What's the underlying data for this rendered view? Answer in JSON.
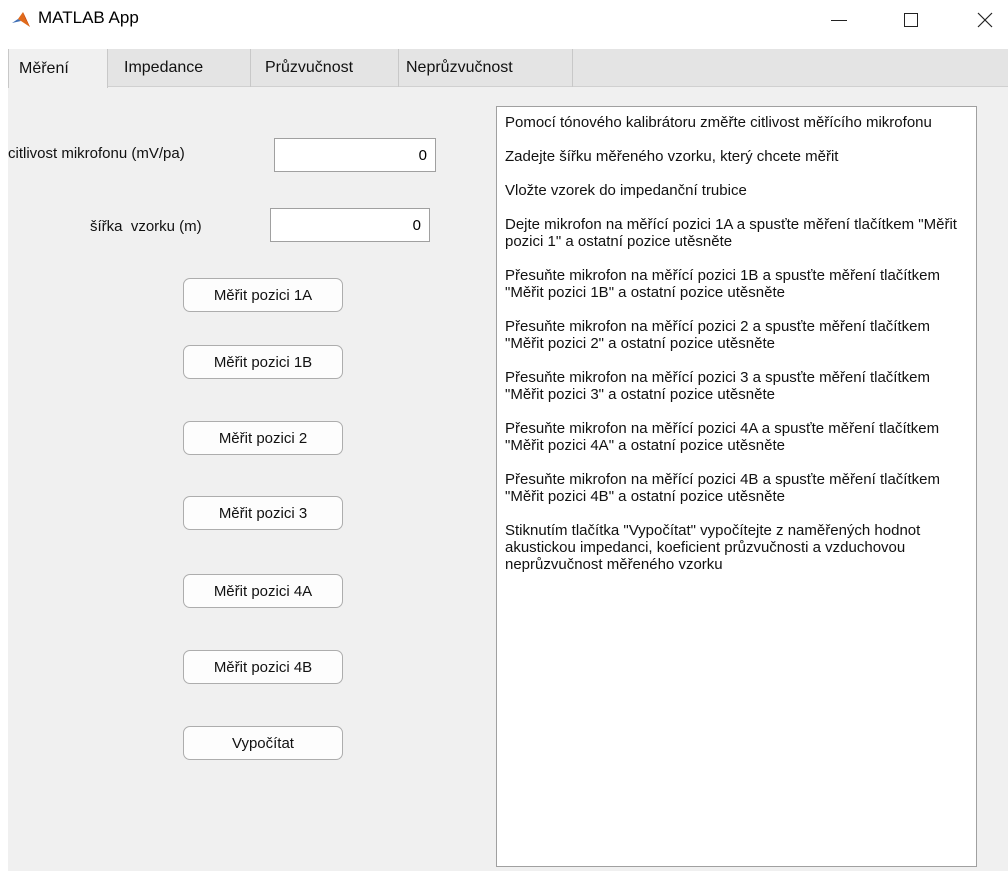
{
  "window": {
    "title": "MATLAB App",
    "icon": "matlab-logo-icon"
  },
  "tabs": [
    {
      "label": "Měření",
      "active": true
    },
    {
      "label": "Impedance",
      "active": false
    },
    {
      "label": "Průzvučnost",
      "active": false
    },
    {
      "label": "Neprůzvučnost",
      "active": false
    }
  ],
  "form": {
    "sensitivity_label": "citlivost mikrofonu (mV/pa)",
    "sensitivity_value": "0",
    "width_label": "šířka  vzorku (m)",
    "width_value": "0"
  },
  "buttons": [
    "Měřit pozici 1A",
    "Měřit pozici 1B",
    "Měřit pozici 2",
    "Měřit pozici 3",
    "Měřit pozici 4A",
    "Měřit pozici 4B",
    "Vypočítat"
  ],
  "instructions": [
    "Pomocí tónového kalibrátoru změřte citlivost měřícího mikrofonu",
    "Zadejte šířku měřeného vzorku, který chcete měřit",
    "Vložte vzorek do impedanční trubice",
    "Dejte mikrofon na měřící pozici 1A a spusťte měření tlačítkem \"Měřit pozici 1\" a ostatní pozice utěsněte",
    "Přesuňte mikrofon na měřící pozici 1B a spusťte měření tlačítkem \"Měřit pozici 1B\" a ostatní pozice utěsněte",
    "Přesuňte mikrofon na měřící pozici 2 a spusťte měření tlačítkem \"Měřit pozici 2\" a ostatní pozice utěsněte",
    "Přesuňte mikrofon na měřící pozici 3 a spusťte měření tlačítkem \"Měřit pozici 3\" a ostatní pozice utěsněte",
    "Přesuňte mikrofon na měřící pozici 4A a spusťte měření tlačítkem \"Měřit pozici 4A\" a ostatní pozice utěsněte",
    "Přesuňte mikrofon na měřící pozici 4B a spusťte měření tlačítkem \"Měřit pozici 4B\" a ostatní pozice utěsněte",
    "Stiknutím tlačítka \"Vypočítat\" vypočítejte z naměřených hodnot akustickou impedanci, koeficient průzvučnosti a vzduchovou neprůzvučnost měřeného vzorku"
  ]
}
